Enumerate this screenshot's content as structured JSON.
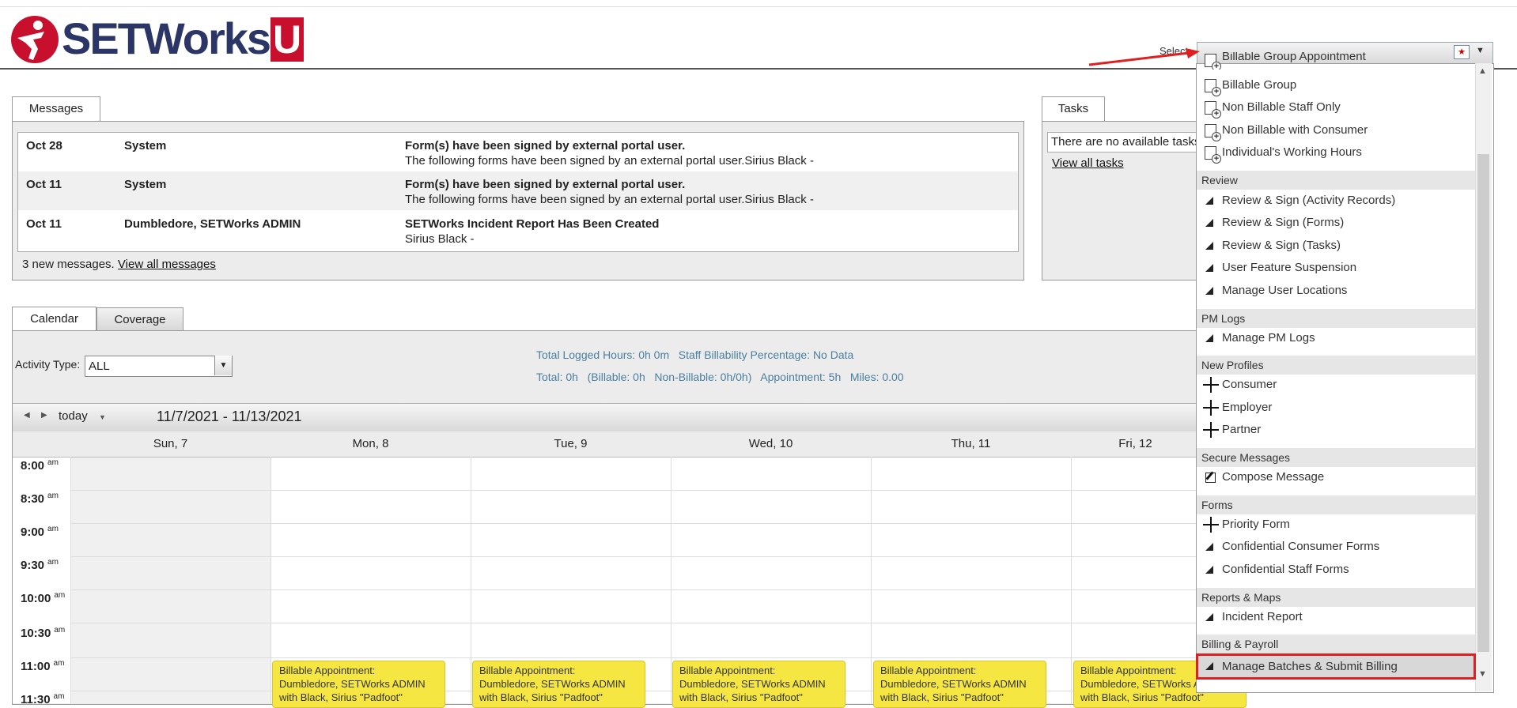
{
  "header": {
    "logo_text": "SETWorks",
    "logo_u": "U",
    "select_label": "Select:"
  },
  "messages": {
    "tab_label": "Messages",
    "rows": [
      {
        "date": "Oct 28",
        "from": "System",
        "subject": "Form(s) have been signed by external portal user.",
        "body": "The following forms have been signed by an external portal user.Sirius Black -"
      },
      {
        "date": "Oct 11",
        "from": "System",
        "subject": "Form(s) have been signed by external portal user.",
        "body": "The following forms have been signed by an external portal user.Sirius Black -"
      },
      {
        "date": "Oct 11",
        "from": "Dumbledore, SETWorks ADMIN",
        "subject": "SETWorks Incident Report Has Been Created",
        "body": "Sirius Black -"
      }
    ],
    "summary_count": "3 new messages.",
    "view_all": "View all messages"
  },
  "tasks": {
    "tab_label": "Tasks",
    "empty_text": "There are no available tasks.",
    "view_all": "View all tasks"
  },
  "calendar": {
    "tab_calendar": "Calendar",
    "tab_coverage": "Coverage",
    "activity_label": "Activity Type:",
    "activity_value": "ALL",
    "stats_line1": "Total Logged Hours: 0h 0m   Staff Billability Percentage: No Data",
    "stats_line2": "Total: 0h   (Billable: 0h   Non-Billable: 0h/0h)   Appointment: 5h   Miles: 0.00",
    "today_label": "today",
    "date_range": "11/7/2021 - 11/13/2021",
    "days": [
      "Sun, 7",
      "Mon, 8",
      "Tue, 9",
      "Wed, 10",
      "Thu, 11",
      "Fri, 12"
    ],
    "times": [
      {
        "t": "8:00",
        "ap": "am"
      },
      {
        "t": "8:30",
        "ap": "am"
      },
      {
        "t": "9:00",
        "ap": "am"
      },
      {
        "t": "9:30",
        "ap": "am"
      },
      {
        "t": "10:00",
        "ap": "am"
      },
      {
        "t": "10:30",
        "ap": "am"
      },
      {
        "t": "11:00",
        "ap": "am"
      },
      {
        "t": "11:30",
        "ap": "am"
      }
    ],
    "event": {
      "line1": "Billable Appointment:",
      "line2": "Dumbledore, SETWorks ADMIN",
      "line3": "with Black, Sirius \"Padfoot\""
    }
  },
  "dropdown": {
    "partial_top": "Billable Group Appointment",
    "items_top": [
      "Billable Group",
      "Non Billable Staff Only",
      "Non Billable with Consumer",
      "Individual's Working Hours"
    ],
    "review_head": "Review",
    "review_items": [
      "Review & Sign (Activity Records)",
      "Review & Sign (Forms)",
      "Review & Sign (Tasks)",
      "User Feature Suspension",
      "Manage User Locations"
    ],
    "pm_head": "PM Logs",
    "pm_items": [
      "Manage PM Logs"
    ],
    "profiles_head": "New Profiles",
    "profiles_items": [
      "Consumer",
      "Employer",
      "Partner"
    ],
    "secure_head": "Secure Messages",
    "secure_items": [
      "Compose Message"
    ],
    "forms_head": "Forms",
    "forms_items": [
      "Priority Form",
      "Confidential Consumer Forms",
      "Confidential Staff Forms"
    ],
    "reports_head": "Reports & Maps",
    "reports_items": [
      "Incident Report"
    ],
    "billing_head": "Billing & Payroll",
    "billing_items": [
      "Manage Batches & Submit Billing"
    ]
  },
  "colors": {
    "brand_red": "#c8102e",
    "brand_navy": "#2b3566",
    "event_yellow": "#f5e642",
    "highlight_border": "#e02020",
    "stats_text": "#4a7fa0"
  }
}
